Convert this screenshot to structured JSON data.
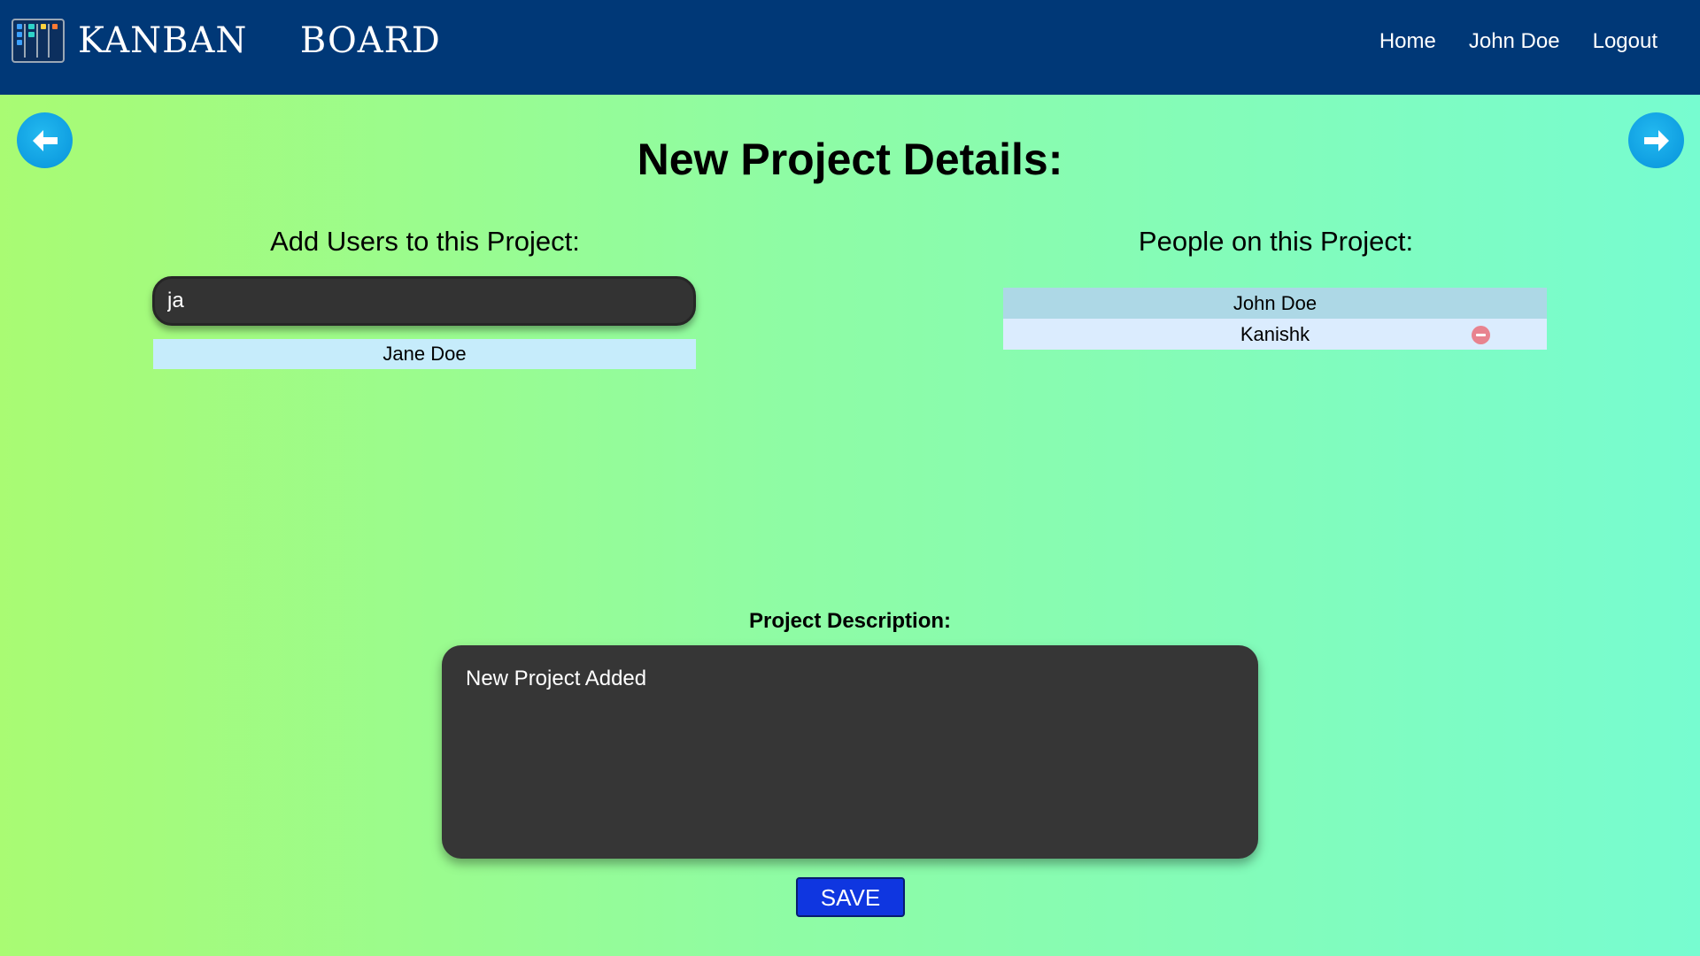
{
  "navbar": {
    "brand": "KANBAN  BOARD",
    "links": [
      "Home",
      "John Doe",
      "Logout"
    ],
    "background": "#003877"
  },
  "page": {
    "title": "New Project Details:"
  },
  "add_users": {
    "heading": "Add Users to this Project:",
    "search_value": "ja",
    "suggestions": [
      "Jane Doe"
    ]
  },
  "people": {
    "heading": "People on this Project:",
    "members": [
      "John Doe",
      "Kanishk"
    ]
  },
  "description": {
    "label": "Project Description:",
    "value": "New Project Added"
  },
  "actions": {
    "save_label": "SAVE"
  },
  "icons": {
    "back": "arrow-left-icon",
    "forward": "arrow-right-icon",
    "remove": "remove-circle-icon",
    "logo": "kanban-logo-icon"
  },
  "colors": {
    "save_button": "#0f36e0",
    "arrow_button": "#0f9ee1",
    "input_background": "#333333",
    "suggestion_background": "#c6ecfb",
    "owner_row": "#add8e6",
    "member_row": "#dbecfe",
    "remove_icon": "#e8838f"
  }
}
